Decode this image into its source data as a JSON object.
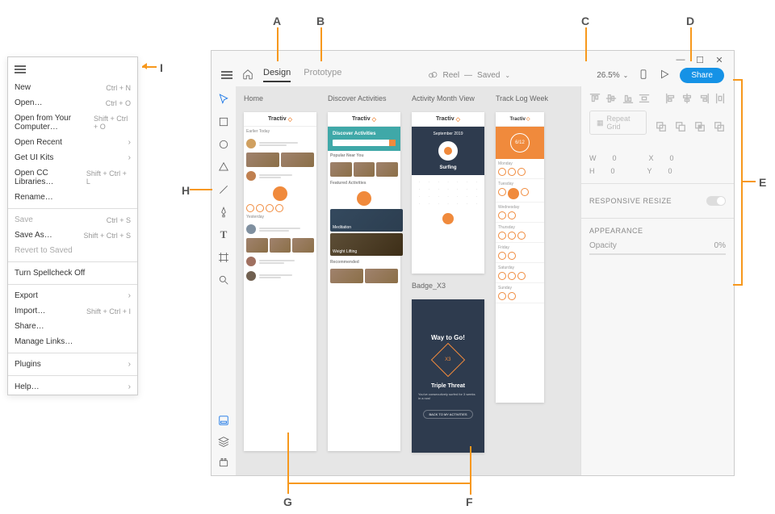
{
  "labels": {
    "A": "A",
    "B": "B",
    "C": "C",
    "D": "D",
    "E": "E",
    "F": "F",
    "G": "G",
    "H": "H",
    "I": "I"
  },
  "menu": {
    "items": [
      {
        "label": "New",
        "shortcut": "Ctrl + N"
      },
      {
        "label": "Open…",
        "shortcut": "Ctrl + O"
      },
      {
        "label": "Open from Your Computer…",
        "shortcut": "Shift + Ctrl + O"
      },
      {
        "label": "Open Recent",
        "submenu": true
      },
      {
        "label": "Get UI Kits",
        "submenu": true
      },
      {
        "label": "Open CC Libraries…",
        "shortcut": "Shift + Ctrl + L"
      },
      {
        "label": "Rename…"
      }
    ],
    "items2": [
      {
        "label": "Save",
        "shortcut": "Ctrl + S",
        "disabled": true
      },
      {
        "label": "Save As…",
        "shortcut": "Shift + Ctrl + S"
      },
      {
        "label": "Revert to Saved",
        "disabled": true
      }
    ],
    "items3": [
      {
        "label": "Turn Spellcheck Off"
      }
    ],
    "items4": [
      {
        "label": "Export",
        "submenu": true
      },
      {
        "label": "Import…",
        "shortcut": "Shift + Ctrl + I"
      },
      {
        "label": "Share…"
      },
      {
        "label": "Manage Links…"
      }
    ],
    "items5": [
      {
        "label": "Plugins",
        "submenu": true
      }
    ],
    "items6": [
      {
        "label": "Help…",
        "submenu": true
      }
    ]
  },
  "topbar": {
    "tabs": {
      "design": "Design",
      "prototype": "Prototype"
    },
    "doc": {
      "name": "Reel",
      "status": "Saved"
    },
    "zoom": "26.5%",
    "share": "Share"
  },
  "artboards": {
    "home": "Home",
    "discover": "Discover Activities",
    "month": "Activity Month View",
    "tracklog": "Track Log Week",
    "badge": "Badge_X3",
    "brand": "Tractiv",
    "hero_title": "Discover Activities",
    "popular": "Popular Near You",
    "featured": "Featured Activities",
    "meditation": "Meditation",
    "weight": "Weight Lifting",
    "recommended": "Recommended",
    "surfing": "Surfing",
    "way": "Way to Go!",
    "x3": "X3",
    "triple": "Triple Threat",
    "earlier": "Earlier Today",
    "yesterday": "Yesterday",
    "month_label": "September 2019",
    "days": {
      "mon": "Monday",
      "tue": "Tuesday",
      "wed": "Wednesday",
      "thu": "Thursday",
      "fri": "Friday",
      "sat": "Saturday",
      "sun": "Sunday"
    },
    "orange_metric": "6/12"
  },
  "panel": {
    "repeat_grid": "Repeat Grid",
    "w": "W",
    "w_val": "0",
    "h": "H",
    "h_val": "0",
    "x": "X",
    "x_val": "0",
    "y": "Y",
    "y_val": "0",
    "responsive": "RESPONSIVE RESIZE",
    "appearance": "APPEARANCE",
    "opacity": "Opacity",
    "opacity_val": "0%"
  }
}
